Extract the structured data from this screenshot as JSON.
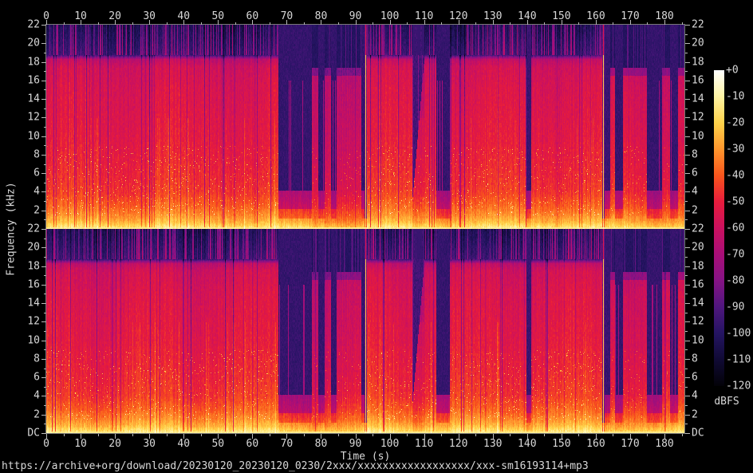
{
  "caption": {
    "text": "https://archive+org/download/20230120_20230120_0230/2xxx/xxxxxxxxxxxxxxxxxx/xxx-sm16193114+mp3"
  },
  "axes": {
    "xlabel": "Time (s)",
    "ylabel": "Frequency (kHz)",
    "time_tick_labels": [
      "0",
      "10",
      "20",
      "30",
      "40",
      "50",
      "60",
      "70",
      "80",
      "90",
      "100",
      "110",
      "120",
      "130",
      "140",
      "150",
      "160",
      "170",
      "180"
    ],
    "time_major_step_s": 10,
    "time_minor_step_s": 5,
    "time_axis_max_s": 185.8,
    "freq_tick_labels": [
      "22",
      "20",
      "18",
      "16",
      "14",
      "12",
      "10",
      "8",
      "6",
      "4",
      "2"
    ],
    "freq_dc_label": "DC",
    "freq_major_step_khz": 2,
    "freq_minor_step_khz": 1,
    "freq_max_khz": 22
  },
  "colorbar": {
    "unit": "dBFS",
    "tick_labels": [
      "+0",
      "-10",
      "-20",
      "-30",
      "-40",
      "-50",
      "-60",
      "-70",
      "-80",
      "-90",
      "-100",
      "-110",
      "-120"
    ]
  },
  "colors": {
    "background": "#000000",
    "tick": "#b9b9b9",
    "text": "#d9d9d9",
    "frame": "#787878"
  },
  "chart_data": {
    "type": "heatmap",
    "subtype": "stereo-audio-spectrogram",
    "channels": [
      "channel-1-top",
      "channel-2-bottom"
    ],
    "x_axis": {
      "label": "Time (s)",
      "range_s": [
        0,
        185.8
      ],
      "tick_step_s": 10
    },
    "y_axis": {
      "label": "Frequency (kHz)",
      "range_khz": [
        0,
        22
      ],
      "tick_step_khz": 2,
      "bottom_label": "DC"
    },
    "z_axis": {
      "label": "dBFS",
      "range_db": [
        -120,
        0
      ],
      "tick_step_db": 10
    },
    "palette_stops": [
      {
        "db": 0,
        "rgb": [
          255,
          255,
          255
        ]
      },
      {
        "db": -10,
        "rgb": [
          255,
          244,
          164
        ]
      },
      {
        "db": -20,
        "rgb": [
          255,
          211,
          74
        ]
      },
      {
        "db": -30,
        "rgb": [
          255,
          150,
          45
        ]
      },
      {
        "db": -40,
        "rgb": [
          249,
          85,
          28
        ]
      },
      {
        "db": -50,
        "rgb": [
          232,
          28,
          60
        ]
      },
      {
        "db": -60,
        "rgb": [
          203,
          17,
          95
        ]
      },
      {
        "db": -70,
        "rgb": [
          169,
          14,
          120
        ]
      },
      {
        "db": -80,
        "rgb": [
          133,
          19,
          133
        ]
      },
      {
        "db": -90,
        "rgb": [
          79,
          22,
          126
        ]
      },
      {
        "db": -100,
        "rgb": [
          36,
          20,
          98
        ]
      },
      {
        "db": -110,
        "rgb": [
          16,
          10,
          52
        ]
      },
      {
        "db": -120,
        "rgb": [
          3,
          2,
          8
        ]
      }
    ],
    "level_profile_db": [
      [
        0,
        -12
      ],
      [
        0.3,
        -16
      ],
      [
        0.8,
        -24
      ],
      [
        1.5,
        -31
      ],
      [
        2.5,
        -38
      ],
      [
        4,
        -45
      ],
      [
        6,
        -48
      ],
      [
        10,
        -52
      ],
      [
        15,
        -55
      ],
      [
        17.5,
        -58
      ],
      [
        18.3,
        -64
      ],
      [
        18.8,
        -95
      ],
      [
        22,
        -104
      ]
    ],
    "segments": [
      {
        "start": 0,
        "end": 67.5,
        "type": "music"
      },
      {
        "start": 67.5,
        "end": 92.6,
        "type": "sparse"
      },
      {
        "start": 92.6,
        "end": 93.4,
        "type": "spike"
      },
      {
        "start": 93.4,
        "end": 106.5,
        "type": "music"
      },
      {
        "start": 106.5,
        "end": 110.0,
        "type": "fade"
      },
      {
        "start": 110.0,
        "end": 113.5,
        "type": "music"
      },
      {
        "start": 113.5,
        "end": 117.5,
        "type": "sparse"
      },
      {
        "start": 117.5,
        "end": 139.8,
        "type": "music"
      },
      {
        "start": 139.8,
        "end": 141.2,
        "type": "gap"
      },
      {
        "start": 141.2,
        "end": 161.8,
        "type": "music"
      },
      {
        "start": 161.8,
        "end": 162.6,
        "type": "spike"
      },
      {
        "start": 162.6,
        "end": 164.2,
        "type": "gap"
      },
      {
        "start": 164.2,
        "end": 185.8,
        "type": "sparse2"
      }
    ]
  }
}
